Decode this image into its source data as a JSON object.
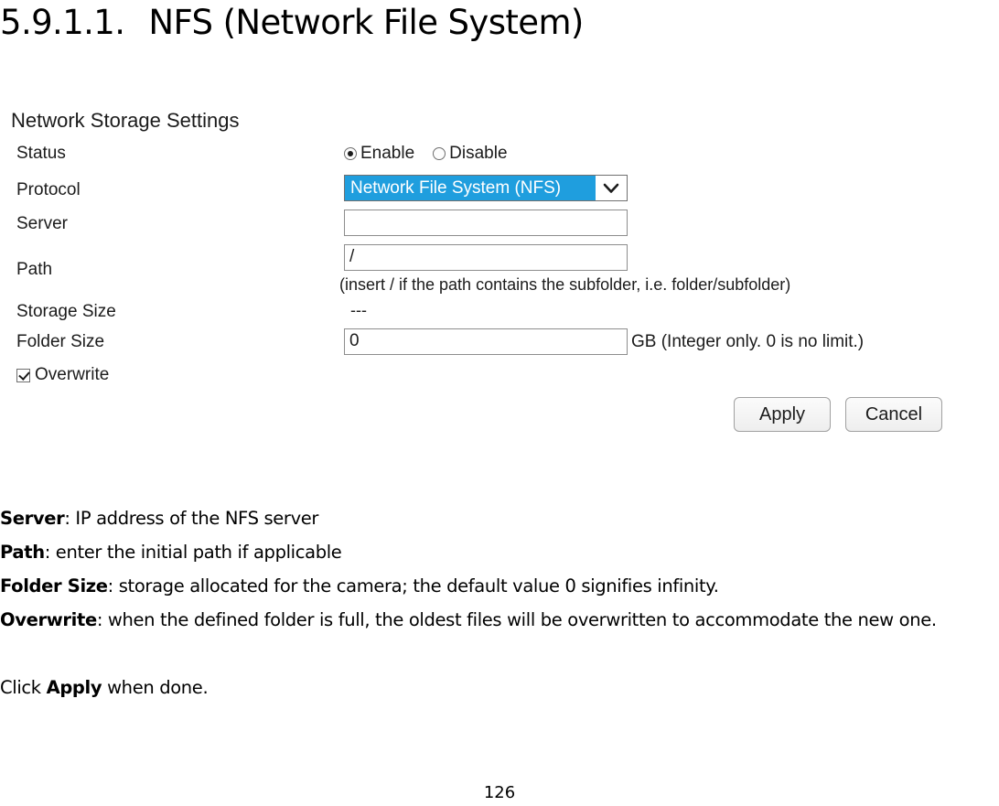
{
  "document": {
    "section_number": "5.9.1.1.",
    "section_title": "NFS (Network File System)",
    "page_number": "126"
  },
  "panel": {
    "heading": "Network Storage Settings",
    "labels": {
      "status": "Status",
      "protocol": "Protocol",
      "server": "Server",
      "path": "Path",
      "storage_size": "Storage Size",
      "folder_size": "Folder Size",
      "overwrite": "Overwrite"
    },
    "status": {
      "enable_label": "Enable",
      "disable_label": "Disable",
      "selected": "Enable"
    },
    "protocol": {
      "selected": "Network File System (NFS)",
      "highlight_color": "#1f9ede",
      "highlight_text_color": "#ffffff"
    },
    "server": {
      "value": "",
      "placeholder": ""
    },
    "path": {
      "value": "/",
      "hint": "(insert / if the path contains the subfolder, i.e. folder/subfolder)"
    },
    "storage_size": {
      "value": "---"
    },
    "folder_size": {
      "value": "0",
      "unit_note": "GB (Integer only. 0 is no limit.)"
    },
    "overwrite": {
      "checked": true
    },
    "buttons": {
      "apply": "Apply",
      "cancel": "Cancel"
    }
  },
  "descriptions": [
    {
      "term": "Server",
      "text": ": IP address of the NFS server"
    },
    {
      "term": "Path",
      "text": ": enter the initial path if applicable"
    },
    {
      "term": "Folder Size",
      "text": ": storage allocated for the camera; the default value 0 signifies infinity."
    },
    {
      "term": "Overwrite",
      "text": ": when the defined folder is full, the oldest files will be overwritten to accommodate the new one."
    }
  ],
  "closing": {
    "prefix": "Click ",
    "bold": "Apply",
    "suffix": " when done."
  }
}
